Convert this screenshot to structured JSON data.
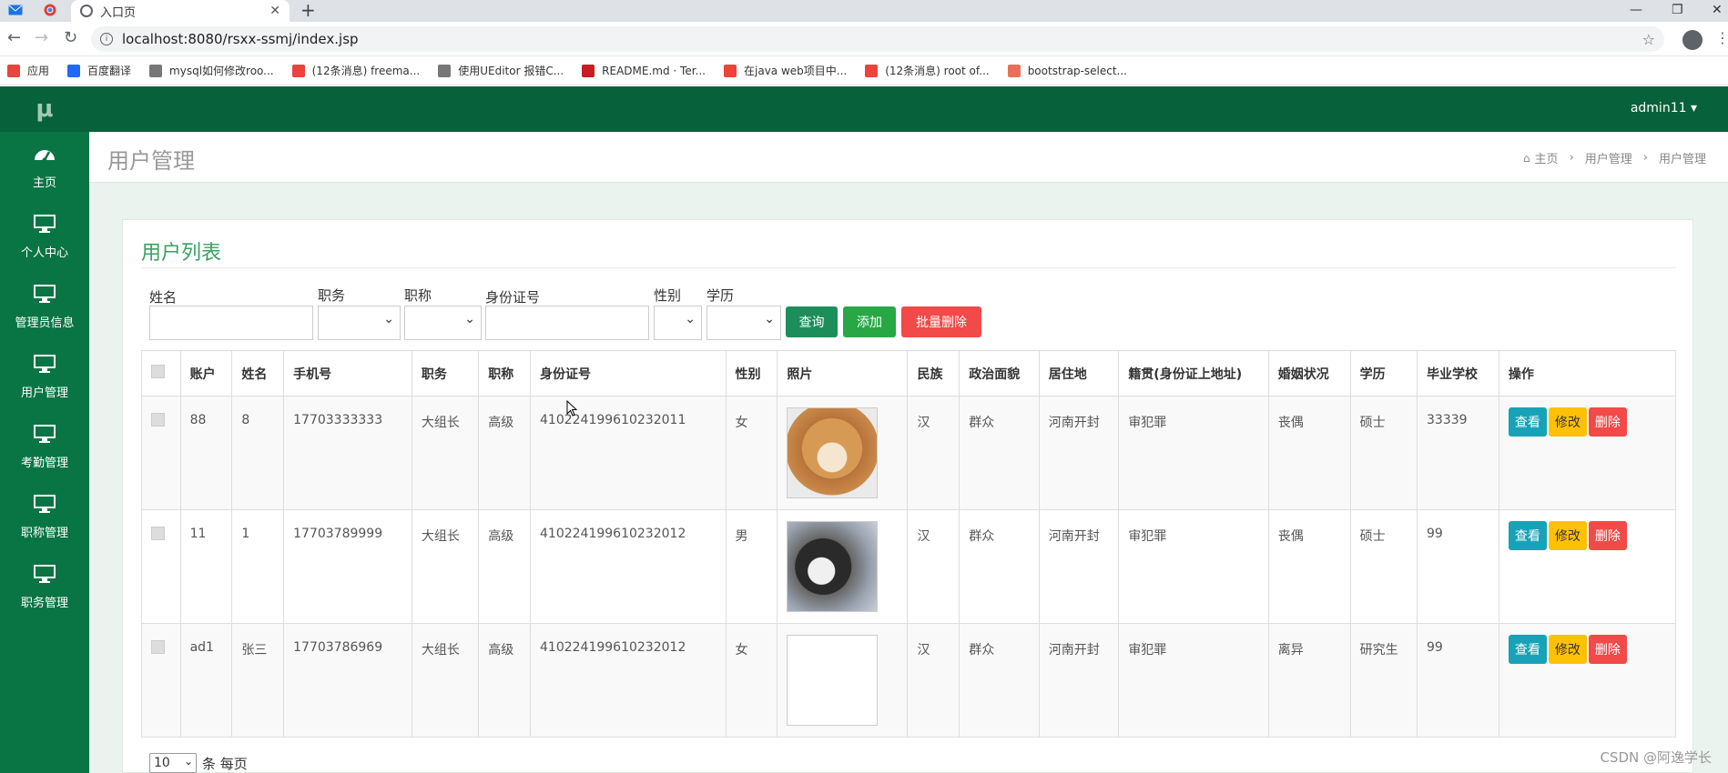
{
  "browser": {
    "tab_title": "入口页",
    "url": "localhost:8080/rsxx-ssmj/index.jsp",
    "bookmarks": [
      {
        "label": "应用",
        "icon": "apps-icon",
        "color": "#e8453c"
      },
      {
        "label": "百度翻译",
        "icon": "translate-icon",
        "color": "#2468f2"
      },
      {
        "label": "mysql如何修改roo...",
        "icon": "bookmark-icon",
        "color": "#777777"
      },
      {
        "label": "(12条消息) freema...",
        "icon": "csdn-icon",
        "color": "#e8453c"
      },
      {
        "label": "使用UEditor 报错C...",
        "icon": "bookmark-icon",
        "color": "#777777"
      },
      {
        "label": "README.md · Ter...",
        "icon": "gitee-icon",
        "color": "#c71d23"
      },
      {
        "label": "在java web项目中...",
        "icon": "csdn-icon",
        "color": "#e8453c"
      },
      {
        "label": "(12条消息) root of...",
        "icon": "csdn-icon",
        "color": "#e8453c"
      },
      {
        "label": "bootstrap-select...",
        "icon": "jianshu-icon",
        "color": "#ea6f5a"
      }
    ]
  },
  "sidebar": {
    "logo": "μ",
    "items": [
      {
        "label": "主页",
        "icon": "dashboard-icon"
      },
      {
        "label": "个人中心",
        "icon": "monitor-icon"
      },
      {
        "label": "管理员信息",
        "icon": "monitor-icon"
      },
      {
        "label": "用户管理",
        "icon": "monitor-icon"
      },
      {
        "label": "考勤管理",
        "icon": "monitor-icon"
      },
      {
        "label": "职称管理",
        "icon": "monitor-icon"
      },
      {
        "label": "职务管理",
        "icon": "monitor-icon"
      }
    ]
  },
  "header": {
    "user": "admin11 ▾"
  },
  "page": {
    "title": "用户管理",
    "breadcrumb": {
      "home": "主页",
      "level1": "用户管理",
      "level2": "用户管理"
    }
  },
  "card": {
    "title": "用户列表"
  },
  "filters": {
    "name_label": "姓名",
    "position_label": "职务",
    "title_label": "职称",
    "idcard_label": "身份证号",
    "gender_label": "性别",
    "education_label": "学历",
    "search_button": "查询",
    "add_button": "添加",
    "batch_delete_button": "批量删除"
  },
  "table": {
    "headers": [
      "账户",
      "姓名",
      "手机号",
      "职务",
      "职称",
      "身份证号",
      "性别",
      "照片",
      "民族",
      "政治面貌",
      "居住地",
      "籍贯(身份证上地址)",
      "婚姻状况",
      "学历",
      "毕业学校",
      "操作"
    ],
    "rows": [
      {
        "account": "88",
        "name": "8",
        "phone": "17703333333",
        "position": "大组长",
        "title": "高级",
        "idcard": "410224199610232011",
        "gender": "女",
        "photo": "dog1",
        "ethnicity": "汉",
        "political": "群众",
        "residence": "河南开封",
        "origin": "审犯罪",
        "marital": "丧偶",
        "education": "硕士",
        "school": "33339"
      },
      {
        "account": "11",
        "name": "1",
        "phone": "17703789999",
        "position": "大组长",
        "title": "高级",
        "idcard": "410224199610232012",
        "gender": "男",
        "photo": "dog2",
        "ethnicity": "汉",
        "political": "群众",
        "residence": "河南开封",
        "origin": "审犯罪",
        "marital": "丧偶",
        "education": "硕士",
        "school": "99"
      },
      {
        "account": "ad1",
        "name": "张三",
        "phone": "17703786969",
        "position": "大组长",
        "title": "高级",
        "idcard": "410224199610232012",
        "gender": "女",
        "photo": "empty",
        "ethnicity": "汉",
        "political": "群众",
        "residence": "河南开封",
        "origin": "审犯罪",
        "marital": "离异",
        "education": "研究生",
        "school": "99"
      }
    ],
    "actions": {
      "view": "查看",
      "edit": "修改",
      "delete": "删除"
    }
  },
  "pager": {
    "page_size": "10",
    "suffix": "条 每页"
  },
  "watermark": "CSDN @阿逸学长",
  "colors": {
    "primary": "#0a7544",
    "dark": "#07613a",
    "info": "#17a2b8",
    "warning": "#ffc107",
    "danger": "#f24949",
    "success": "#28a745"
  }
}
